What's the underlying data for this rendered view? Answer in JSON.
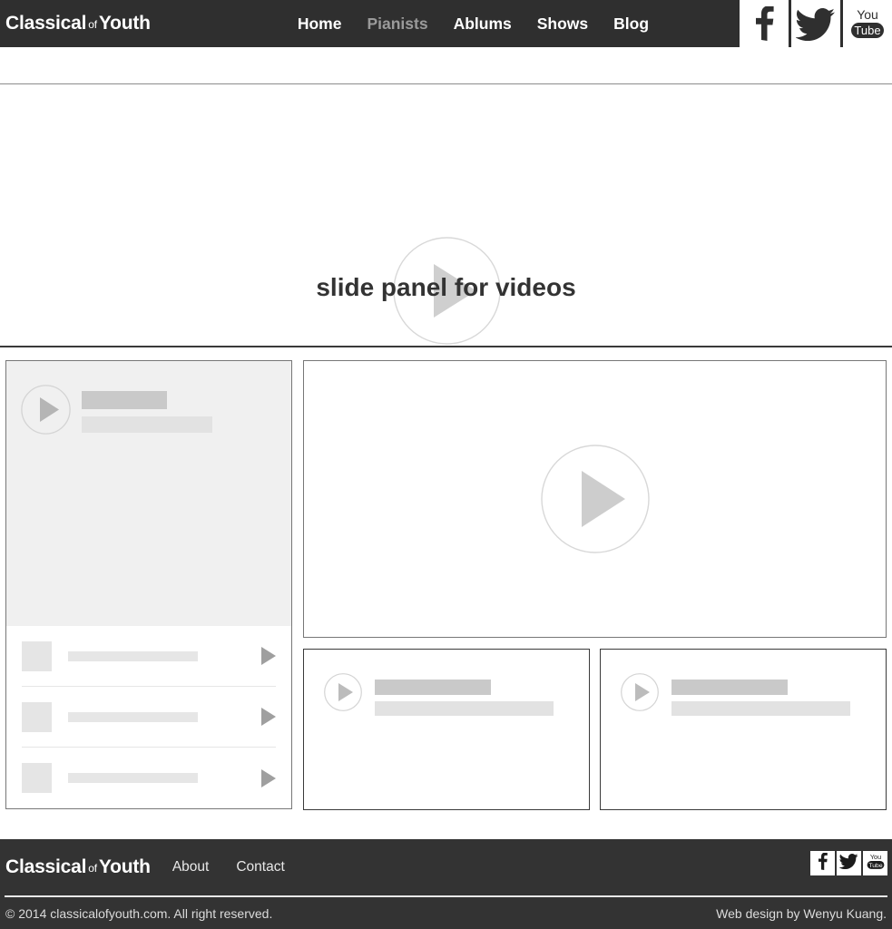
{
  "site": {
    "brand_part1": "Classical",
    "brand_connector": "of",
    "brand_part2": "Youth",
    "header_bg": "#2f2f2f",
    "footer_bg": "#333333",
    "accent_text": "#ffffff",
    "inactive_nav": "#9a9a9a"
  },
  "header": {
    "nav": [
      {
        "label": "Home",
        "state": "active"
      },
      {
        "label": "Pianists",
        "state": "inactive"
      },
      {
        "label": "Ablums",
        "state": "active"
      },
      {
        "label": "Shows",
        "state": "active"
      },
      {
        "label": "Blog",
        "state": "active"
      }
    ],
    "social": [
      {
        "name": "facebook-icon",
        "label": "Facebook"
      },
      {
        "name": "twitter-icon",
        "label": "Twitter"
      },
      {
        "name": "youtube-icon",
        "label": "YouTube"
      }
    ]
  },
  "hero": {
    "caption": "slide panel for videos",
    "play_icon": "play-circle-icon"
  },
  "sidebar": {
    "featured": {
      "play_icon": "play-circle-icon",
      "title_placeholder": "",
      "subtitle_placeholder": ""
    },
    "playlist": [
      {
        "thumb": "thumbnail-placeholder",
        "title_placeholder": "",
        "play_icon": "play-triangle-icon"
      },
      {
        "thumb": "thumbnail-placeholder",
        "title_placeholder": "",
        "play_icon": "play-triangle-icon"
      },
      {
        "thumb": "thumbnail-placeholder",
        "title_placeholder": "",
        "play_icon": "play-triangle-icon"
      }
    ]
  },
  "main_video": {
    "play_icon": "play-circle-icon"
  },
  "video_cards": [
    {
      "play_icon": "play-circle-icon",
      "title_placeholder": "",
      "subtitle_placeholder": ""
    },
    {
      "play_icon": "play-circle-icon",
      "title_placeholder": "",
      "subtitle_placeholder": ""
    }
  ],
  "footer": {
    "nav": [
      {
        "label": "About"
      },
      {
        "label": "Contact"
      }
    ],
    "social": [
      {
        "name": "facebook-icon",
        "label": "Facebook"
      },
      {
        "name": "twitter-icon",
        "label": "Twitter"
      },
      {
        "name": "youtube-icon",
        "label": "YouTube"
      }
    ],
    "copyright": "© 2014 classicalofyouth.com. All right reserved.",
    "credit": "Web design by Wenyu Kuang."
  }
}
